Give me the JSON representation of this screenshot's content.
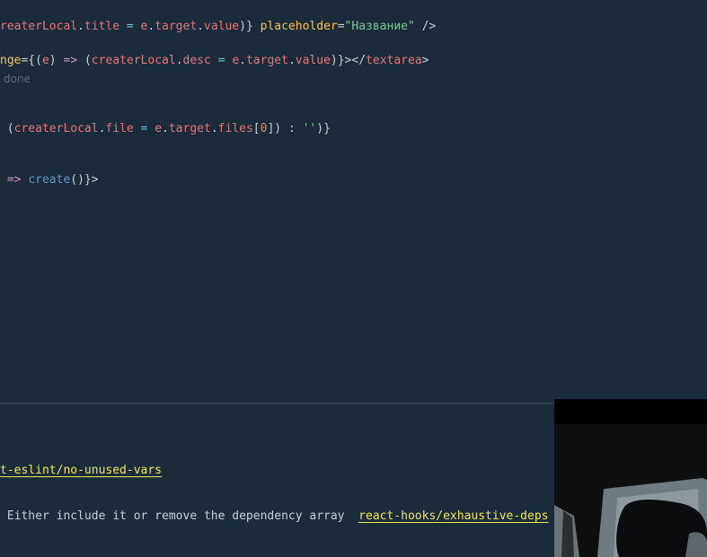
{
  "editor": {
    "line1": {
      "p1": "reaterLocal",
      "p2": ".",
      "p3": "title",
      "p4": " = ",
      "p5": "e",
      "p6": ".",
      "p7": "target",
      "p8": ".",
      "p9": "value",
      "p10": ")}",
      "p11": " placeholder",
      "p12": "=",
      "p13": "\"Название\"",
      "p14": " />"
    },
    "line2": {
      "p1": "nge",
      "p2": "={(",
      "p3": "e",
      "p4": ") ",
      "p5": "=>",
      "p6": " (",
      "p7": "createrLocal",
      "p8": ".",
      "p9": "desc",
      "p10": " = ",
      "p11": "e",
      "p12": ".",
      "p13": "target",
      "p14": ".",
      "p15": "value",
      "p16": ")}></",
      "p17": "textarea",
      "p18": ">"
    },
    "ghost_text": "done",
    "line3": {
      "p1": " (",
      "p2": "createrLocal",
      "p3": ".",
      "p4": "file",
      "p5": " = ",
      "p6": "e",
      "p7": ".",
      "p8": "target",
      "p9": ".",
      "p10": "files",
      "p11": "[",
      "p12": "0",
      "p13": "]) : ",
      "p14": "''",
      "p15": ")}"
    },
    "line4": {
      "p1": " => ",
      "p2": "create",
      "p3": "()}>"
    }
  },
  "problems": {
    "item1": {
      "rule": "t-eslint/no-unused-vars"
    },
    "item2": {
      "message": " Either include it or remove the dependency array  ",
      "rule": "react-hooks/exhaustive-deps"
    }
  },
  "colors": {
    "background": "#1b2b3a",
    "link": "#f2e65a",
    "property": "#e2777a",
    "string": "#7ec699",
    "attribute": "#f8c555",
    "keyword": "#cc99cd"
  },
  "icons": [
    "webcam-overlay"
  ]
}
